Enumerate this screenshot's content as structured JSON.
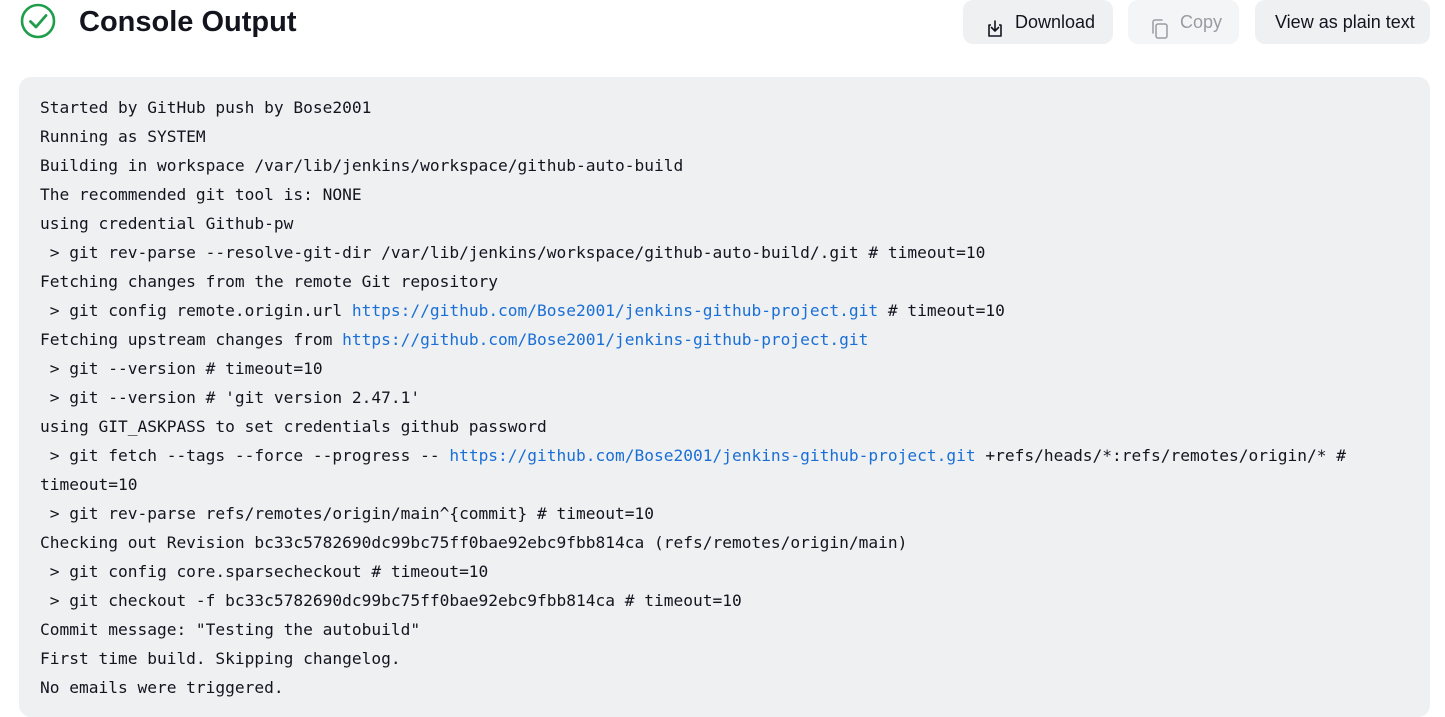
{
  "header": {
    "status_icon": "check-circle-icon",
    "title": "Console Output",
    "accent_color": "#1e9e4a"
  },
  "toolbar": {
    "download_label": "Download",
    "download_icon": "download-icon",
    "copy_label": "Copy",
    "copy_icon": "copy-icon",
    "copy_disabled": true,
    "plain_text_label": "View as plain text"
  },
  "console": {
    "link_color": "#1a6fd6",
    "lines": [
      [
        {
          "t": "Started by GitHub push by Bose2001"
        }
      ],
      [
        {
          "t": "Running as SYSTEM"
        }
      ],
      [
        {
          "t": "Building in workspace /var/lib/jenkins/workspace/github-auto-build"
        }
      ],
      [
        {
          "t": "The recommended git tool is: NONE"
        }
      ],
      [
        {
          "t": "using credential Github-pw"
        }
      ],
      [
        {
          "t": " > git rev-parse --resolve-git-dir /var/lib/jenkins/workspace/github-auto-build/.git # timeout=10"
        }
      ],
      [
        {
          "t": "Fetching changes from the remote Git repository"
        }
      ],
      [
        {
          "t": " > git config remote.origin.url "
        },
        {
          "t": "https://github.com/Bose2001/jenkins-github-project.git",
          "link": true
        },
        {
          "t": " # timeout=10"
        }
      ],
      [
        {
          "t": "Fetching upstream changes from "
        },
        {
          "t": "https://github.com/Bose2001/jenkins-github-project.git",
          "link": true
        }
      ],
      [
        {
          "t": " > git --version # timeout=10"
        }
      ],
      [
        {
          "t": " > git --version # 'git version 2.47.1'"
        }
      ],
      [
        {
          "t": "using GIT_ASKPASS to set credentials github password"
        }
      ],
      [
        {
          "t": " > git fetch --tags --force --progress -- "
        },
        {
          "t": "https://github.com/Bose2001/jenkins-github-project.git",
          "link": true
        },
        {
          "t": " +refs/heads/*:refs/remotes/origin/* #"
        }
      ],
      [
        {
          "t": "timeout=10"
        }
      ],
      [
        {
          "t": " > git rev-parse refs/remotes/origin/main^{commit} # timeout=10"
        }
      ],
      [
        {
          "t": "Checking out Revision bc33c5782690dc99bc75ff0bae92ebc9fbb814ca (refs/remotes/origin/main)"
        }
      ],
      [
        {
          "t": " > git config core.sparsecheckout # timeout=10"
        }
      ],
      [
        {
          "t": " > git checkout -f bc33c5782690dc99bc75ff0bae92ebc9fbb814ca # timeout=10"
        }
      ],
      [
        {
          "t": "Commit message: \"Testing the autobuild\""
        }
      ],
      [
        {
          "t": "First time build. Skipping changelog."
        }
      ],
      [
        {
          "t": "No emails were triggered."
        }
      ]
    ]
  }
}
